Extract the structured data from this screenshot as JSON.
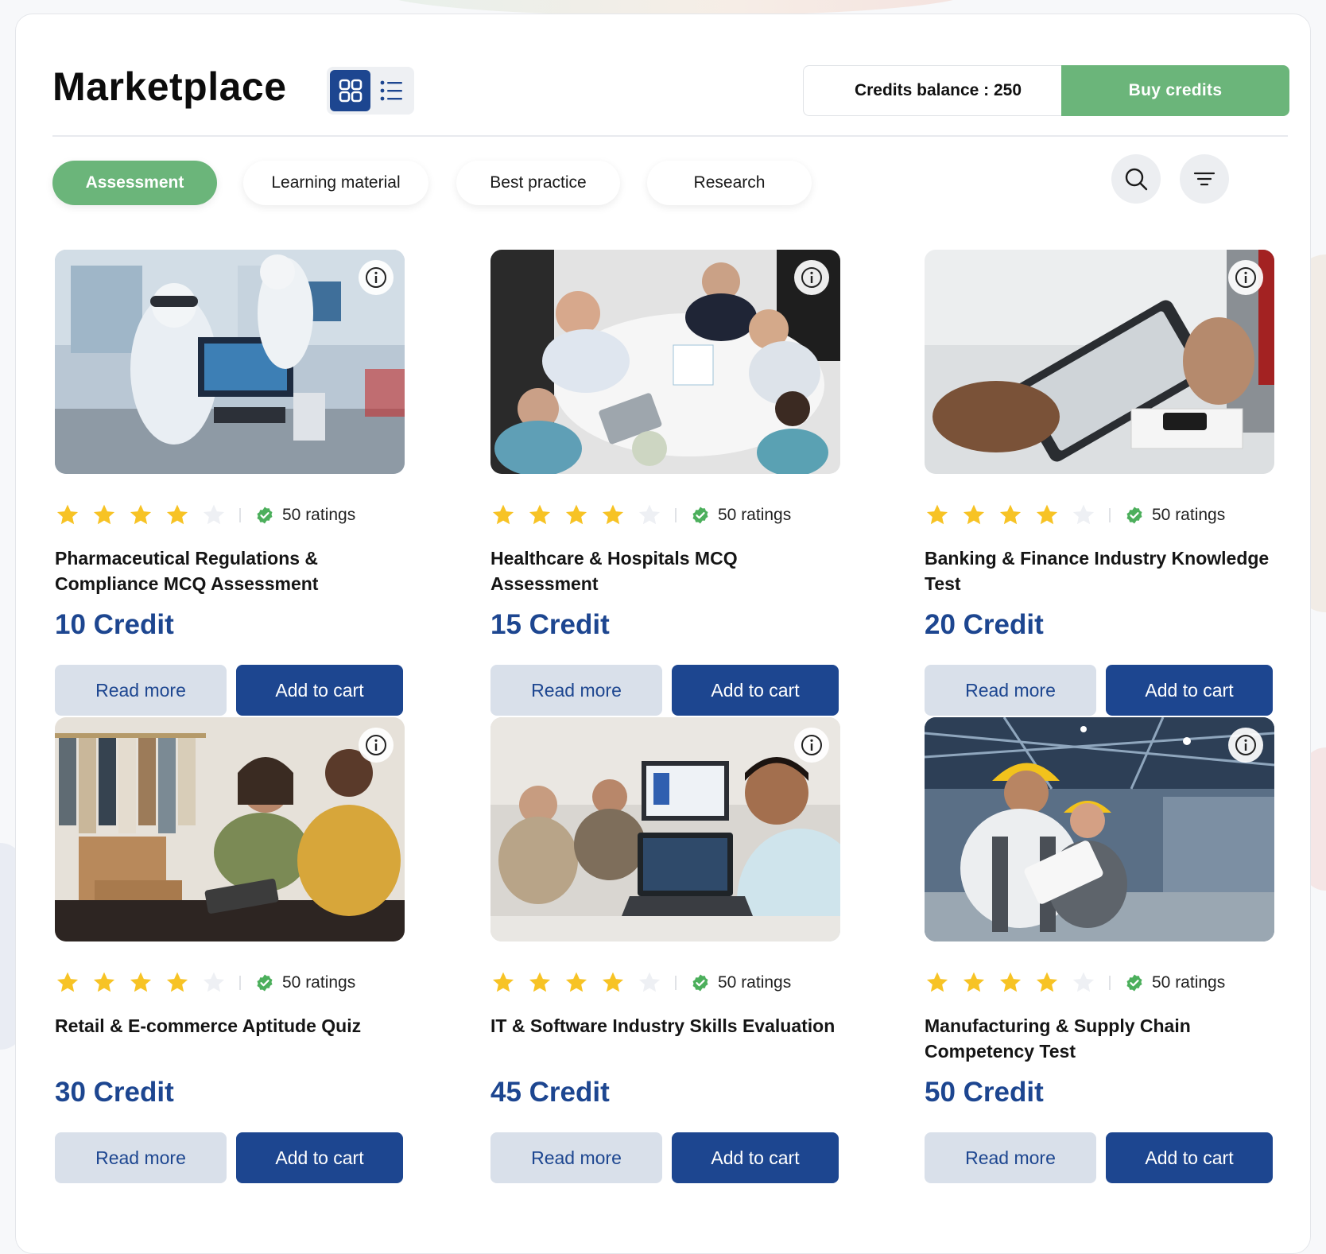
{
  "header": {
    "title": "Marketplace",
    "credits_label": "Credits balance : 250",
    "buy_label": "Buy credits",
    "view_modes": [
      "grid-view-icon",
      "list-view-icon"
    ],
    "active_view": "grid"
  },
  "tabs": [
    {
      "label": "Assessment",
      "active": true
    },
    {
      "label": "Learning material",
      "active": false
    },
    {
      "label": "Best practice",
      "active": false
    },
    {
      "label": "Research",
      "active": false
    }
  ],
  "toolbar_icons": [
    "search-icon",
    "filter-icon"
  ],
  "colors": {
    "accent_green": "#6bb57a",
    "primary_blue": "#1d4690",
    "star_yellow": "#f7c325",
    "star_empty": "#eef0f4",
    "read_more_bg": "#d9e0ea"
  },
  "cards": [
    {
      "title": "Pharmaceutical Regulations & Compliance MCQ Assessment",
      "price": "10 Credit",
      "rating": 4,
      "ratings_text": "50 ratings",
      "read_more": "Read more",
      "add_to_cart": "Add to cart",
      "image": "lab-scientists-photo"
    },
    {
      "title": "Healthcare & Hospitals MCQ Assessment",
      "price": "15 Credit",
      "rating": 4,
      "ratings_text": "50 ratings",
      "read_more": "Read more",
      "add_to_cart": "Add to cart",
      "image": "team-meeting-photo"
    },
    {
      "title": "Banking & Finance Industry Knowledge Test",
      "price": "20 Credit",
      "rating": 4,
      "ratings_text": "50 ratings",
      "read_more": "Read more",
      "add_to_cart": "Add to cart",
      "image": "tablet-handshake-photo"
    },
    {
      "title": "Retail & E-commerce Aptitude Quiz",
      "price": "30 Credit",
      "rating": 4,
      "ratings_text": "50 ratings",
      "read_more": "Read more",
      "add_to_cart": "Add to cart",
      "image": "retail-shop-photo"
    },
    {
      "title": "IT & Software Industry Skills Evaluation",
      "price": "45 Credit",
      "rating": 4,
      "ratings_text": "50 ratings",
      "read_more": "Read more",
      "add_to_cart": "Add to cart",
      "image": "office-laptop-photo"
    },
    {
      "title": "Manufacturing & Supply Chain Competency Test",
      "price": "50 Credit",
      "rating": 4,
      "ratings_text": "50 ratings",
      "read_more": "Read more",
      "add_to_cart": "Add to cart",
      "image": "factory-workers-photo"
    }
  ]
}
